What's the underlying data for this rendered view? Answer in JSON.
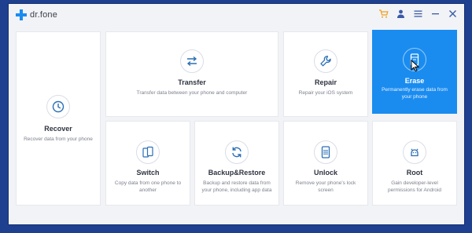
{
  "app": {
    "name": "dr.fone"
  },
  "window_controls": [
    {
      "name": "cart-icon"
    },
    {
      "name": "account-icon"
    },
    {
      "name": "menu-icon"
    },
    {
      "name": "minimize-icon"
    },
    {
      "name": "close-icon"
    }
  ],
  "colors": {
    "accent": "#1a8cf0",
    "icon_blue": "#2a6fb6",
    "background": "#1f3f8f"
  },
  "modules": {
    "recover": {
      "title": "Recover",
      "desc": "Recover data from your phone",
      "icon": "clock-icon"
    },
    "transfer": {
      "title": "Transfer",
      "desc": "Transfer data between your phone and computer",
      "icon": "transfer-arrows-icon"
    },
    "repair": {
      "title": "Repair",
      "desc": "Repair your iOS system",
      "icon": "wrench-icon"
    },
    "erase": {
      "title": "Erase",
      "desc": "Permanently erase data from your phone",
      "icon": "erase-phone-icon",
      "selected": true
    },
    "switch": {
      "title": "Switch",
      "desc": "Copy data from one phone to another",
      "icon": "phone-switch-icon"
    },
    "backup": {
      "title": "Backup&Restore",
      "desc": "Backup and restore data from your phone, including app data",
      "icon": "refresh-icon"
    },
    "unlock": {
      "title": "Unlock",
      "desc": "Remove your phone's lock screen",
      "icon": "lock-screen-icon"
    },
    "root": {
      "title": "Root",
      "desc": "Gain developer-level permissions for Android",
      "icon": "android-icon"
    }
  }
}
